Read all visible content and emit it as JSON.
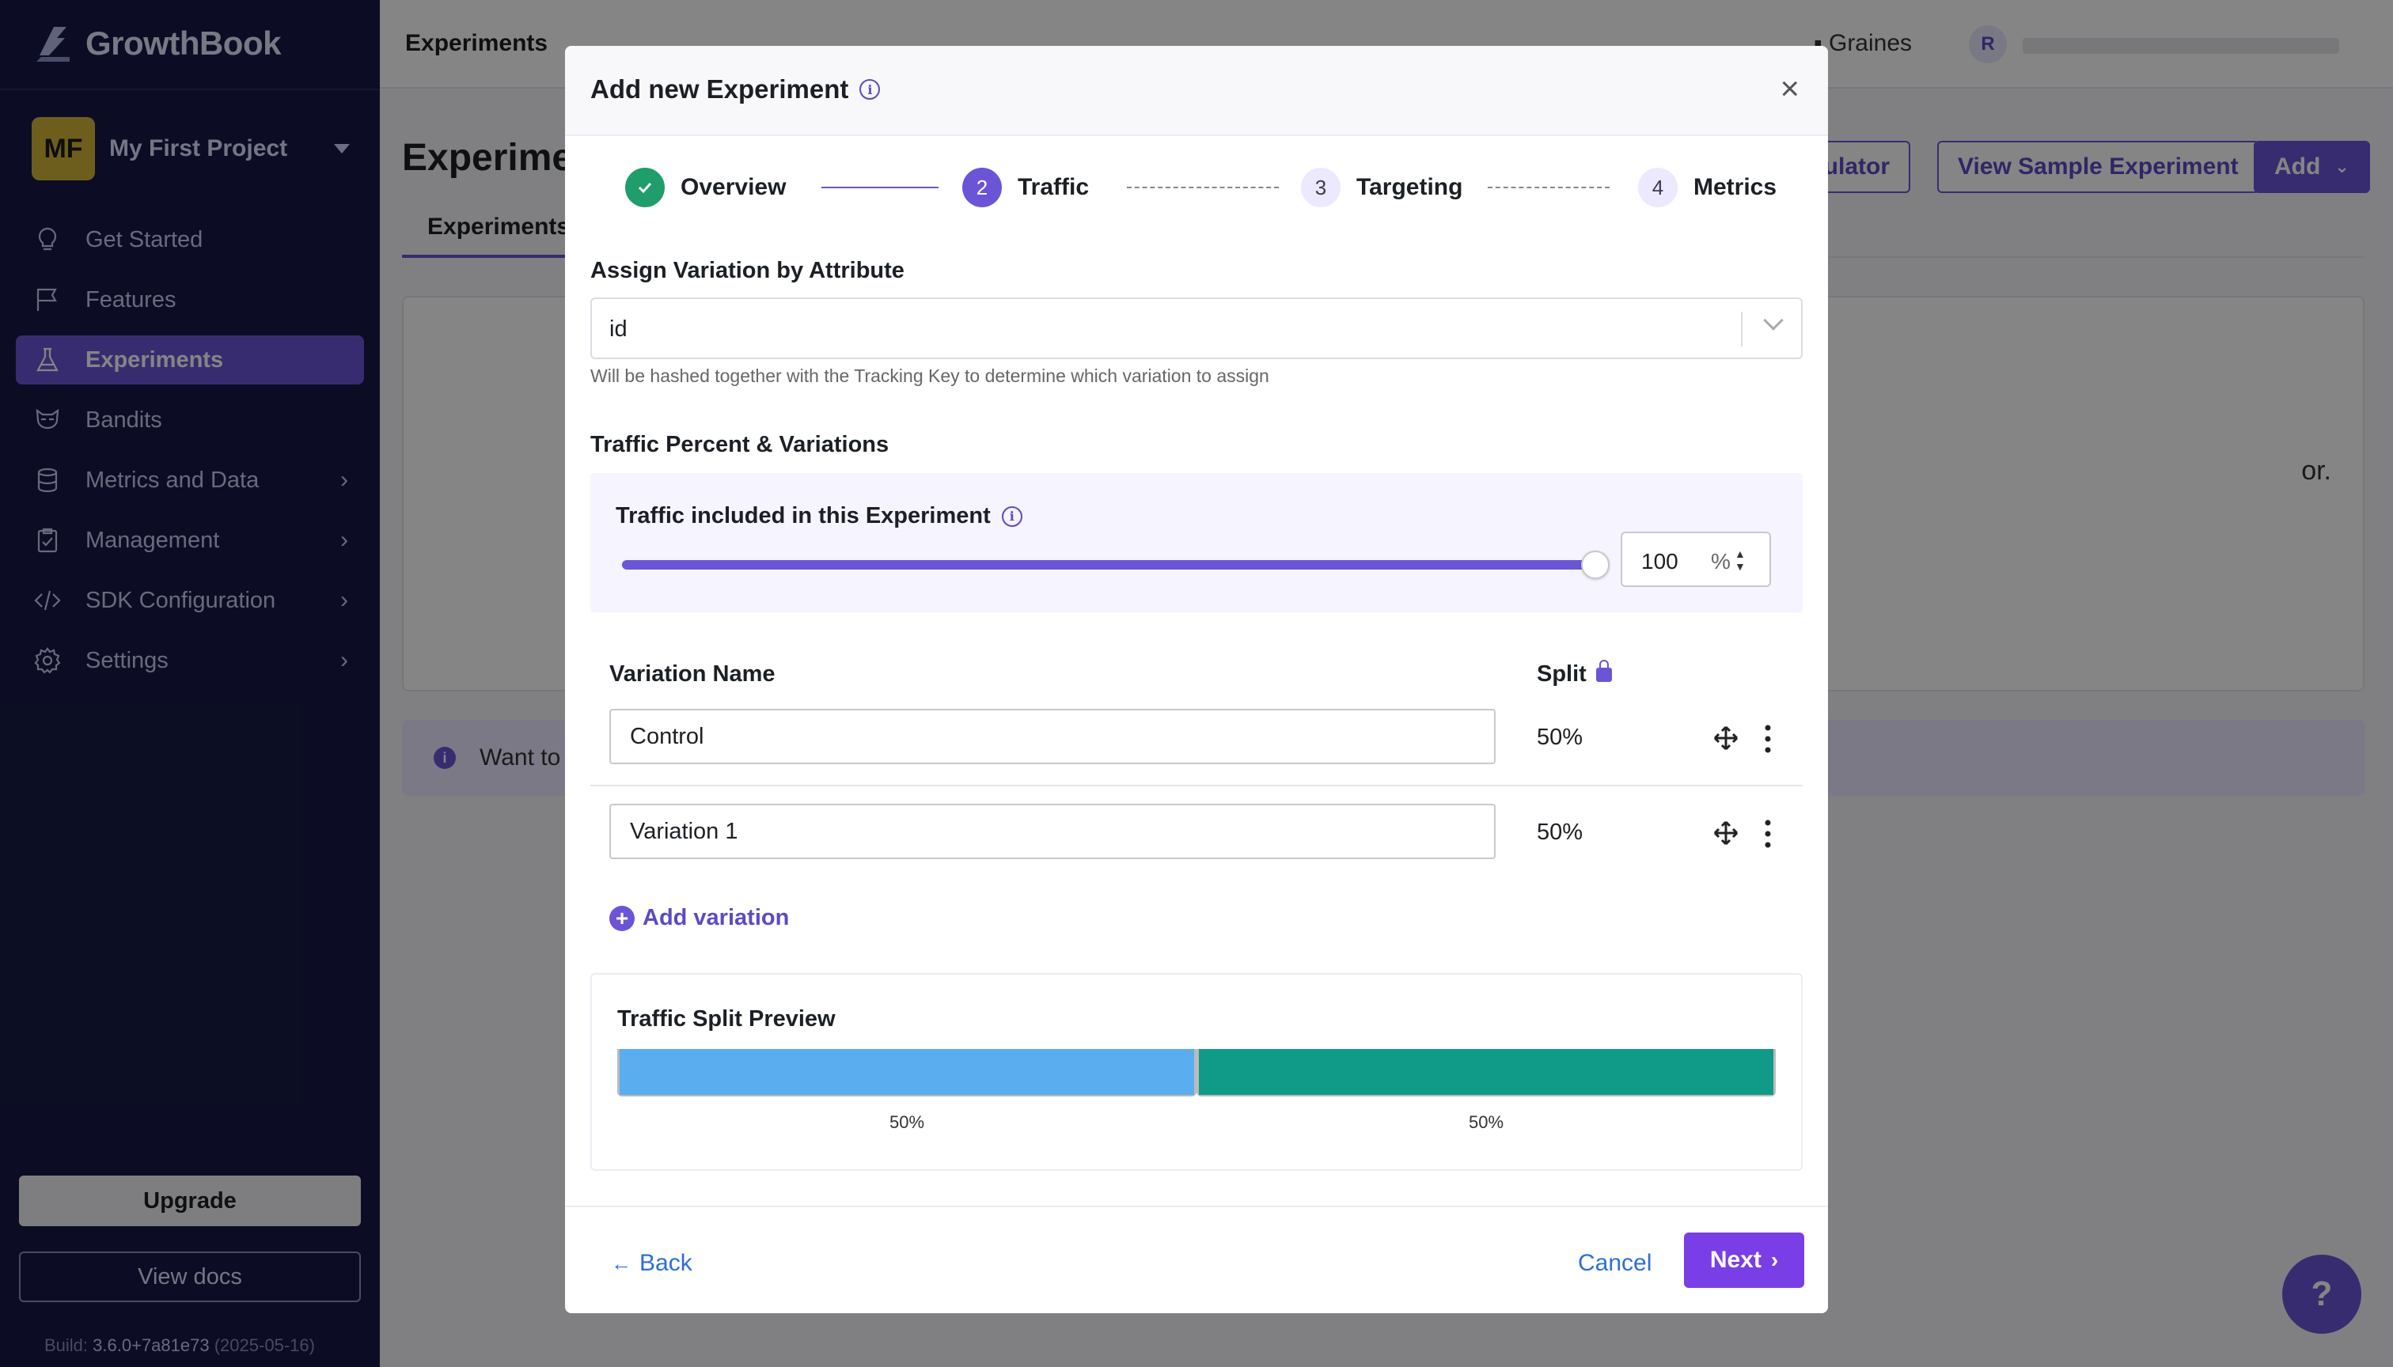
{
  "app": {
    "name": "GrowthBook"
  },
  "sidebar": {
    "project": {
      "initials": "MF",
      "name": "My First Project"
    },
    "items": [
      {
        "label": "Get Started",
        "icon": "lightbulb-icon",
        "active": false,
        "has_submenu": false
      },
      {
        "label": "Features",
        "icon": "flag-icon",
        "active": false,
        "has_submenu": false
      },
      {
        "label": "Experiments",
        "icon": "flask-icon",
        "active": true,
        "has_submenu": false
      },
      {
        "label": "Bandits",
        "icon": "raccoon-icon",
        "active": false,
        "has_submenu": false
      },
      {
        "label": "Metrics and Data",
        "icon": "database-icon",
        "active": false,
        "has_submenu": true
      },
      {
        "label": "Management",
        "icon": "clipboard-icon",
        "active": false,
        "has_submenu": true
      },
      {
        "label": "SDK Configuration",
        "icon": "code-icon",
        "active": false,
        "has_submenu": true
      },
      {
        "label": "Settings",
        "icon": "gear-icon",
        "active": false,
        "has_submenu": true
      }
    ],
    "upgrade_label": "Upgrade",
    "docs_label": "View docs",
    "build_prefix": "Build:",
    "build_version": "3.6.0+7a81e73",
    "build_date": "(2025-05-16)"
  },
  "topbar": {
    "title": "Experiments",
    "org": "Graines",
    "user_initial": "R"
  },
  "page": {
    "title": "Experime",
    "btn_calculator": "culator",
    "btn_sample": "View Sample Experiment",
    "btn_add": "Add",
    "tab_active": "Experiments",
    "empty_text_fragment": "or.",
    "banner_text": "Want to a"
  },
  "modal": {
    "title": "Add new Experiment",
    "steps": [
      {
        "number": "",
        "label": "Overview",
        "state": "done"
      },
      {
        "number": "2",
        "label": "Traffic",
        "state": "current"
      },
      {
        "number": "3",
        "label": "Targeting",
        "state": "todo"
      },
      {
        "number": "4",
        "label": "Metrics",
        "state": "todo"
      }
    ],
    "assign_label": "Assign Variation by Attribute",
    "assign_value": "id",
    "assign_help": "Will be hashed together with the Tracking Key to determine which variation to assign",
    "traffic_section_label": "Traffic Percent & Variations",
    "traffic_included_label": "Traffic included in this Experiment",
    "traffic_percent": "100",
    "traffic_fraction": 1.0,
    "percent_unit": "%",
    "variation_header": "Variation Name",
    "split_header": "Split",
    "variations": [
      {
        "name": "Control",
        "split": "50%"
      },
      {
        "name": "Variation 1",
        "split": "50%"
      }
    ],
    "add_variation_label": "Add variation",
    "preview_title": "Traffic Split Preview",
    "preview": [
      {
        "label": "50%",
        "fraction": 0.5,
        "color": "#5aaeef"
      },
      {
        "label": "50%",
        "fraction": 0.5,
        "color": "#0f9b87"
      }
    ],
    "back_label": "Back",
    "cancel_label": "Cancel",
    "next_label": "Next"
  },
  "help_fab_label": "?"
}
